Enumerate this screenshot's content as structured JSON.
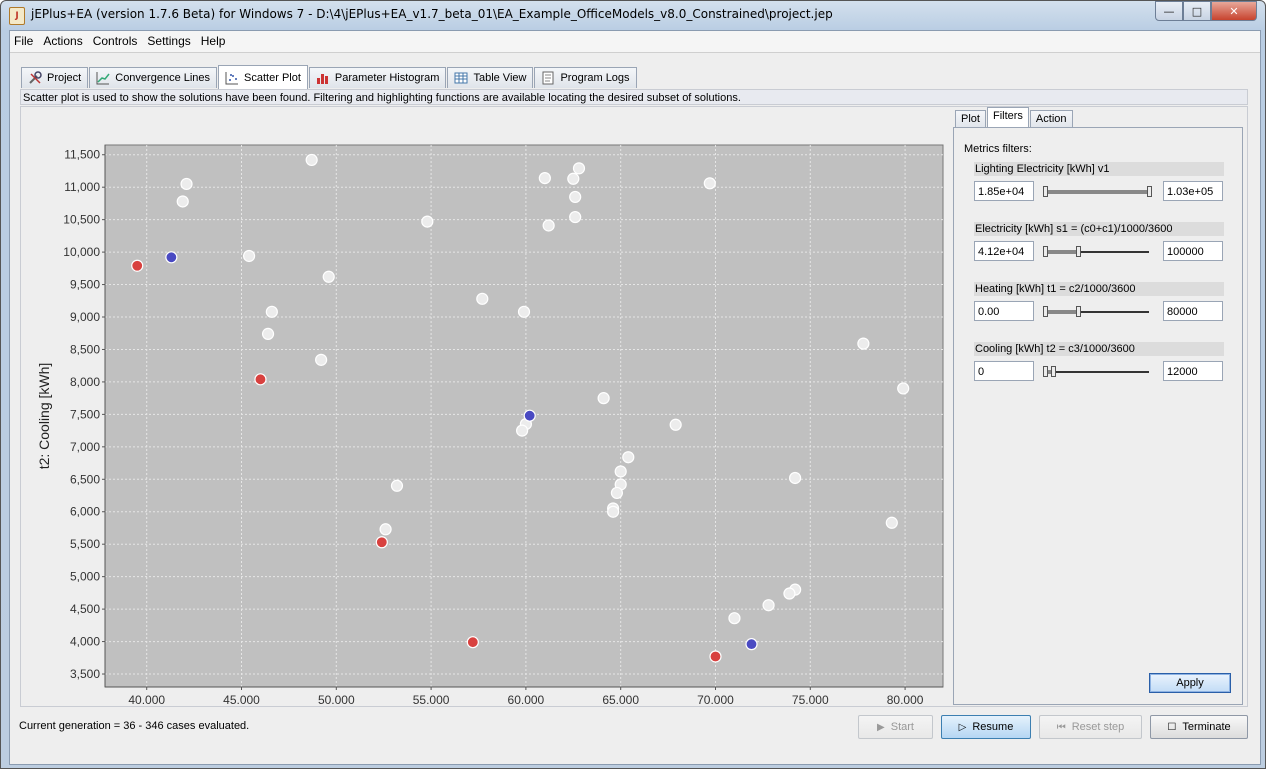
{
  "window": {
    "title": "jEPlus+EA (version 1.7.6 Beta) for Windows 7 - D:\\4\\jEPlus+EA_v1.7_beta_01\\EA_Example_OfficeModels_v8.0_Constrained\\project.jep",
    "app_icon": "J"
  },
  "menu": [
    "File",
    "Actions",
    "Controls",
    "Settings",
    "Help"
  ],
  "tabs": [
    {
      "label": "Project",
      "icon": "tools-icon"
    },
    {
      "label": "Convergence Lines",
      "icon": "line-chart-icon"
    },
    {
      "label": "Scatter Plot",
      "icon": "scatter-icon"
    },
    {
      "label": "Parameter Histogram",
      "icon": "bar-chart-icon"
    },
    {
      "label": "Table View",
      "icon": "table-icon"
    },
    {
      "label": "Program Logs",
      "icon": "log-icon"
    }
  ],
  "description": "Scatter plot is used to show the solutions have been found. Filtering and highlighting functions are available locating the desired subset of solutions.",
  "chart_data": {
    "type": "scatter",
    "xlabel": "t1: Heating [kWh]",
    "ylabel": "t2: Cooling [kWh]",
    "xlim": [
      37800,
      82000
    ],
    "ylim": [
      3300,
      11650
    ],
    "x_ticks": [
      40000,
      45000,
      50000,
      55000,
      60000,
      65000,
      70000,
      75000,
      80000
    ],
    "x_tick_labels": [
      "40,000",
      "45,000",
      "50,000",
      "55,000",
      "60,000",
      "65,000",
      "70,000",
      "75,000",
      "80,000"
    ],
    "y_ticks": [
      3500,
      4000,
      4500,
      5000,
      5500,
      6000,
      6500,
      7000,
      7500,
      8000,
      8500,
      9000,
      9500,
      10000,
      10500,
      11000,
      11500
    ],
    "y_tick_labels": [
      "3,500",
      "4,000",
      "4,500",
      "5,000",
      "5,500",
      "6,000",
      "6,500",
      "7,000",
      "7,500",
      "8,000",
      "8,500",
      "9,000",
      "9,500",
      "10,000",
      "10,500",
      "11,000",
      "11,500"
    ],
    "grid": true,
    "series": [
      {
        "color": "#ececec",
        "points": [
          [
            42100,
            11050
          ],
          [
            41900,
            10780
          ],
          [
            48700,
            11420
          ],
          [
            45400,
            9940
          ],
          [
            46600,
            9080
          ],
          [
            46400,
            8740
          ],
          [
            49600,
            9620
          ],
          [
            49200,
            8340
          ],
          [
            54800,
            10470
          ],
          [
            57700,
            9280
          ],
          [
            59900,
            9080
          ],
          [
            61000,
            11140
          ],
          [
            61200,
            10410
          ],
          [
            62500,
            11130
          ],
          [
            62600,
            10850
          ],
          [
            62600,
            10540
          ],
          [
            62800,
            11290
          ],
          [
            69700,
            11060
          ],
          [
            64100,
            7750
          ],
          [
            67900,
            7340
          ],
          [
            60000,
            7350
          ],
          [
            59800,
            7250
          ],
          [
            65400,
            6840
          ],
          [
            65000,
            6620
          ],
          [
            65000,
            6420
          ],
          [
            64800,
            6290
          ],
          [
            64600,
            6050
          ],
          [
            64600,
            6000
          ],
          [
            53200,
            6400
          ],
          [
            52600,
            5730
          ],
          [
            74200,
            6520
          ],
          [
            77800,
            8590
          ],
          [
            79900,
            7900
          ],
          [
            79300,
            5830
          ],
          [
            74200,
            4800
          ],
          [
            73900,
            4740
          ],
          [
            72800,
            4560
          ],
          [
            71000,
            4360
          ]
        ]
      },
      {
        "color": "#d8413f",
        "points": [
          [
            39500,
            9790
          ],
          [
            46000,
            8040
          ],
          [
            52400,
            5530
          ],
          [
            57200,
            3990
          ],
          [
            70000,
            3770
          ]
        ]
      },
      {
        "color": "#4a4ac2",
        "points": [
          [
            41300,
            9920
          ],
          [
            60200,
            7480
          ],
          [
            71900,
            3960
          ]
        ]
      }
    ]
  },
  "right_tabs": [
    "Plot",
    "Filters",
    "Action"
  ],
  "filters": {
    "title": "Metrics filters:",
    "items": [
      {
        "label": "Lighting Electricity [kWh] v1",
        "min": "1.85e+04",
        "max": "1.03e+05",
        "lo": 0.0,
        "hi": 1.0
      },
      {
        "label": "Electricity [kWh] s1 = (c0+c1)/1000/3600",
        "min": "4.12e+04",
        "max": "100000",
        "lo": 0.0,
        "hi": 0.32
      },
      {
        "label": "Heating [kWh] t1 = c2/1000/3600",
        "min": "0.00",
        "max": "80000",
        "lo": 0.0,
        "hi": 0.32
      },
      {
        "label": "Cooling [kWh] t2 = c3/1000/3600",
        "min": "0",
        "max": "12000",
        "lo": 0.0,
        "hi": 0.08
      }
    ],
    "apply_label": "Apply"
  },
  "status": "Current generation = 36 - 346 cases evaluated.",
  "buttons": {
    "start": "Start",
    "resume": "Resume",
    "reset": "Reset step",
    "terminate": "Terminate"
  }
}
